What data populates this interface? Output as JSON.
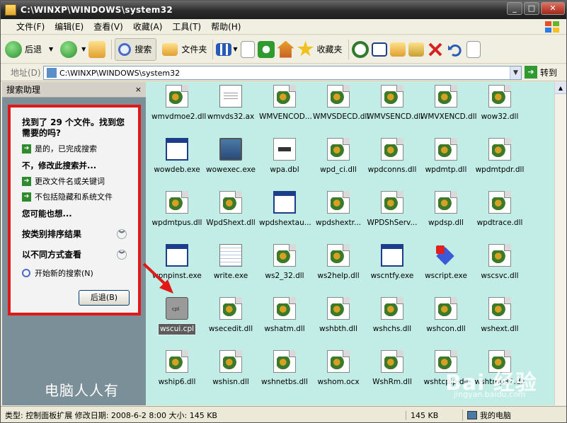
{
  "window": {
    "title": "C:\\WINXP\\WINDOWS\\system32",
    "minimize": "_",
    "maximize": "□",
    "close": "✕"
  },
  "menu": [
    "文件(F)",
    "编辑(E)",
    "查看(V)",
    "收藏(A)",
    "工具(T)",
    "帮助(H)"
  ],
  "toolbar": {
    "back": "后退",
    "search": "搜索",
    "folders": "文件夹",
    "favorites": "收藏夹"
  },
  "address": {
    "label": "地址(D)",
    "value": "C:\\WINXP\\WINDOWS\\system32",
    "go": "转到"
  },
  "assistant": {
    "header": "搜索助理",
    "close": "×",
    "found_title": "找到了 29 个文件。找到您需要的吗?",
    "yes_done": "是的，已完成搜索",
    "refine_title": "不，修改此搜索并...",
    "change_name": "更改文件名或关键词",
    "exclude_hidden": "不包括隐藏和系统文件",
    "maybe_title": "您可能也想...",
    "sort_by_category": "按类别排序结果",
    "view_other": "以不同方式查看",
    "new_search": "开始新的搜索(N)",
    "back_button": "后退(B)"
  },
  "watermark": "电脑人人有",
  "files": [
    {
      "name": "wmvdmoe2.dll",
      "type": "dll"
    },
    {
      "name": "wmvds32.ax",
      "type": "ax"
    },
    {
      "name": "WMVENCOD...",
      "type": "dll"
    },
    {
      "name": "WMVSDECD.dll",
      "type": "dll"
    },
    {
      "name": "WMVSENCD.dll",
      "type": "dll"
    },
    {
      "name": "WMVXENCD.dll",
      "type": "dll"
    },
    {
      "name": "wow32.dll",
      "type": "dll"
    },
    {
      "name": "wowdeb.exe",
      "type": "exe"
    },
    {
      "name": "wowexec.exe",
      "type": "computer"
    },
    {
      "name": "wpa.dbl",
      "type": "dbl"
    },
    {
      "name": "wpd_ci.dll",
      "type": "dll"
    },
    {
      "name": "wpdconns.dll",
      "type": "dll"
    },
    {
      "name": "wpdmtp.dll",
      "type": "dll"
    },
    {
      "name": "wpdmtpdr.dll",
      "type": "dll"
    },
    {
      "name": "wpdmtpus.dll",
      "type": "dll"
    },
    {
      "name": "WpdShext.dll",
      "type": "dll"
    },
    {
      "name": "wpdshextau...",
      "type": "exe"
    },
    {
      "name": "wpdshextr...",
      "type": "dll"
    },
    {
      "name": "WPDShServ...",
      "type": "dll"
    },
    {
      "name": "wpdsp.dll",
      "type": "dll"
    },
    {
      "name": "wpdtrace.dll",
      "type": "dll"
    },
    {
      "name": "wpnpinst.exe",
      "type": "exe"
    },
    {
      "name": "write.exe",
      "type": "notepad"
    },
    {
      "name": "ws2_32.dll",
      "type": "dll"
    },
    {
      "name": "ws2help.dll",
      "type": "dll"
    },
    {
      "name": "wscntfy.exe",
      "type": "exe"
    },
    {
      "name": "wscript.exe",
      "type": "cube"
    },
    {
      "name": "wscsvc.dll",
      "type": "dll"
    },
    {
      "name": "wscui.cpl",
      "type": "cpl",
      "selected": true
    },
    {
      "name": "wsecedit.dll",
      "type": "dll"
    },
    {
      "name": "wshatm.dll",
      "type": "dll"
    },
    {
      "name": "wshbth.dll",
      "type": "dll"
    },
    {
      "name": "wshchs.dll",
      "type": "dll"
    },
    {
      "name": "wshcon.dll",
      "type": "dll"
    },
    {
      "name": "wshext.dll",
      "type": "dll"
    },
    {
      "name": "wship6.dll",
      "type": "dll"
    },
    {
      "name": "wshisn.dll",
      "type": "dll"
    },
    {
      "name": "wshnetbs.dll",
      "type": "dll"
    },
    {
      "name": "wshom.ocx",
      "type": "dll"
    },
    {
      "name": "WshRm.dll",
      "type": "dll"
    },
    {
      "name": "wshtcpip.dll",
      "type": "dll"
    },
    {
      "name": "wshtmp32.dll",
      "type": "dll"
    }
  ],
  "status": {
    "info": "类型: 控制面板扩展 修改日期: 2008-6-2 8:00 大小: 145 KB",
    "size": "145 KB",
    "location": "我的电脑"
  },
  "brand": {
    "logo": "Bai 经验",
    "url": "jingyan.baidu.com"
  },
  "colors": {
    "highlight": "#e01818",
    "content_bg": "#c2ece6"
  }
}
